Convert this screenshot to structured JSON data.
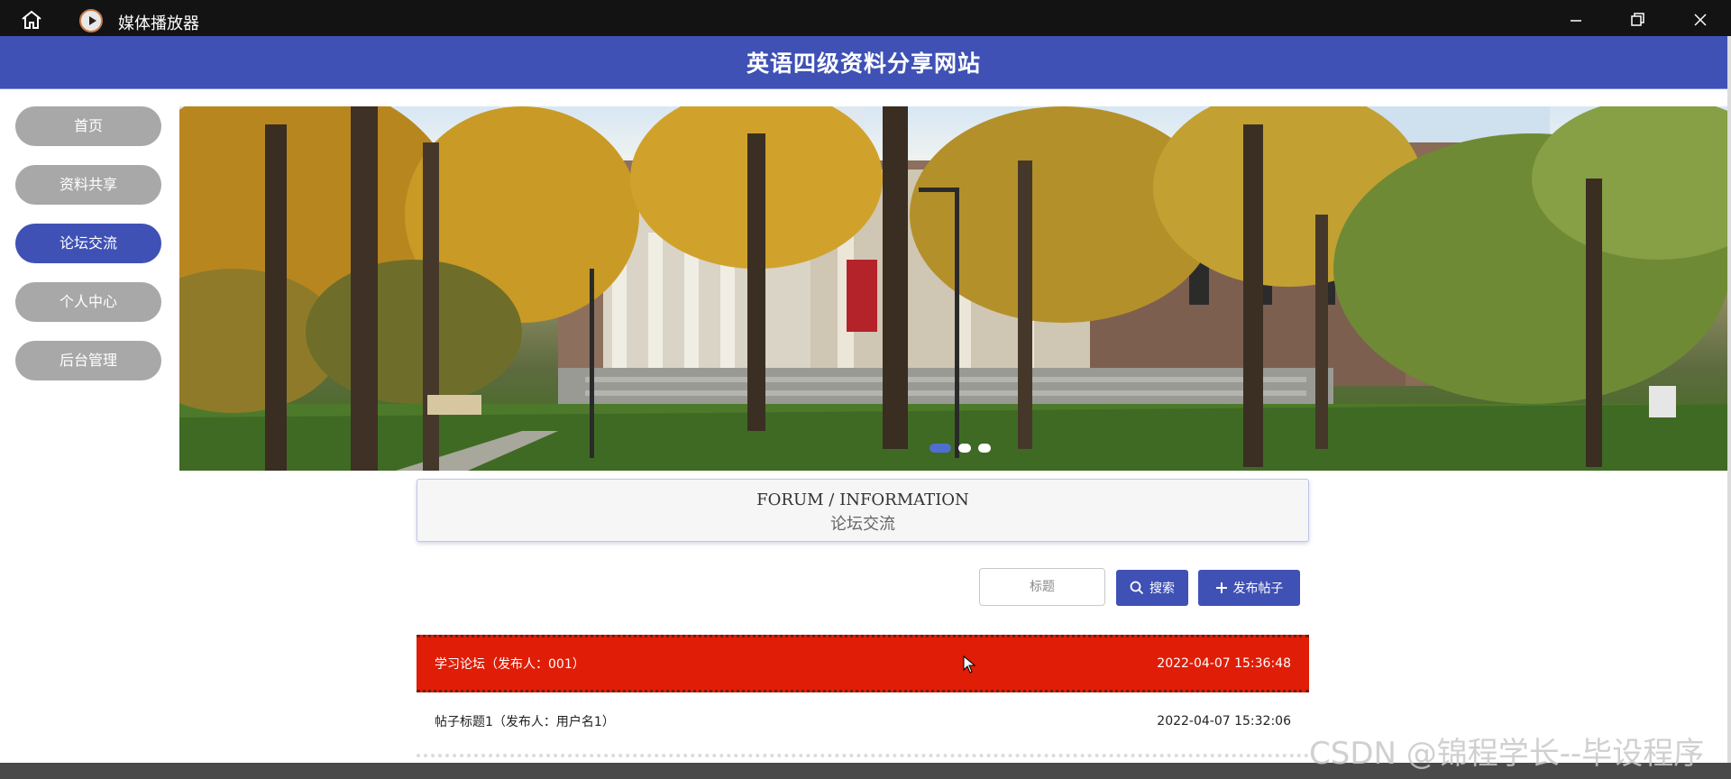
{
  "window": {
    "title": "媒体播放器"
  },
  "site": {
    "title": "英语四级资料分享网站"
  },
  "sidebar": {
    "items": [
      {
        "label": "首页"
      },
      {
        "label": "资料共享"
      },
      {
        "label": "论坛交流"
      },
      {
        "label": "个人中心"
      },
      {
        "label": "后台管理"
      }
    ],
    "active_index": 2
  },
  "banner": {
    "slide_count": 3,
    "active_slide": 1
  },
  "section": {
    "title_en": "FORUM / INFORMATION",
    "title_cn": "论坛交流"
  },
  "toolbar": {
    "search_placeholder": "标题",
    "search_label": "搜索",
    "add_label": "发布帖子"
  },
  "posts": [
    {
      "title": "学习论坛（发布人：001）",
      "time": "2022-04-07 15:36:48",
      "highlighted": true
    },
    {
      "title": "帖子标题1（发布人：用户名1）",
      "time": "2022-04-07 15:32:06",
      "highlighted": false
    }
  ],
  "watermark": "CSDN @锦程学长--毕设程序",
  "colors": {
    "accent": "#3f51b5",
    "highlight_row": "#e01d06",
    "inactive_nav": "#a8a8a8",
    "titlebar": "#131313"
  }
}
